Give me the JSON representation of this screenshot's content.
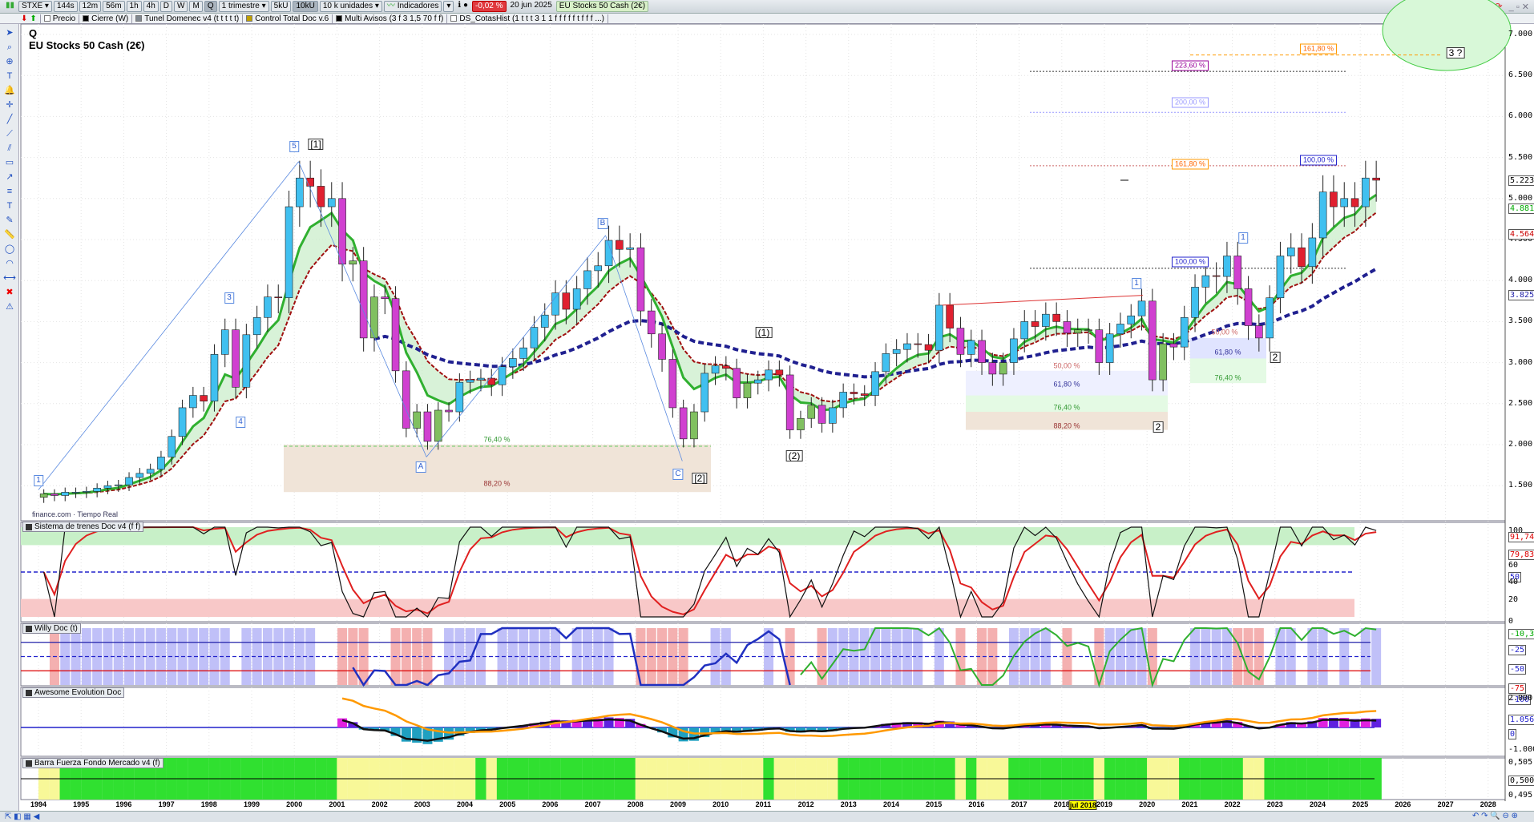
{
  "toolbar": {
    "symbol": "STXE",
    "intervals": [
      "144s",
      "12m",
      "56m",
      "1h",
      "4h",
      "D",
      "W",
      "M",
      "Q"
    ],
    "active_interval": "Q",
    "period": "1 trimestre",
    "units": [
      "5kU",
      "10kU"
    ],
    "active_unit": "10kU",
    "units_select": "10 k unidades",
    "indicators": "Indicadores",
    "change": "-0,02 %",
    "date": "20 jun 2025",
    "instrument": "EU Stocks 50 Cash (2€)"
  },
  "legend": [
    {
      "label": "Precio",
      "color": "#ffffff"
    },
    {
      "label": "Cierre (W)",
      "color": "#000000"
    },
    {
      "label": "Tunel Domenec v4 (t t t t t)",
      "color": "#808890"
    },
    {
      "label": "Control Total Doc v.6",
      "color": "#c0a000"
    },
    {
      "label": "Multi Avisos (3 f 3 1,5 70 f f)",
      "color": "#000000"
    },
    {
      "label": "DS_CotasHist (1 t t t 3 1 1 f f f f f t f f f ...)",
      "color": "#ffffff"
    }
  ],
  "chart": {
    "timeframe": "Q",
    "title": "EU Stocks 50 Cash (2€)",
    "source": "finance.com",
    "realtime": "Tiempo Real"
  },
  "panels": {
    "p2": "Sistema de trenes Doc v4 (f f)",
    "p3": "Willy Doc (t)",
    "p4": "Awesome Evolution Doc",
    "p5": "Barra Fuerza Fondo Mercado v4 (f)"
  },
  "price_axis": [
    "7.000",
    "6.500",
    "6.000",
    "5.500",
    "5.000",
    "4.500",
    "4.000",
    "3.500",
    "3.000",
    "2.500",
    "2.000",
    "1.500"
  ],
  "last_values": {
    "close": "5.223,2",
    "green_ema": "4.881,8",
    "red_ema": "4.564,8",
    "blue_ma": "3.825,2"
  },
  "p2_axis": [
    "100",
    "91,742",
    "79,832",
    "60",
    "50",
    "40",
    "20",
    "0"
  ],
  "p3_axis": [
    "-10,313",
    "-25",
    "-50",
    "-75",
    "-100"
  ],
  "p4_axis": [
    "2.000",
    "1.056,9",
    "0",
    "-1.000"
  ],
  "p5_axis": [
    "0,505",
    "0,5000",
    "0,495"
  ],
  "years": [
    "1994",
    "1995",
    "1996",
    "1997",
    "1998",
    "1999",
    "2000",
    "2001",
    "2002",
    "2003",
    "2004",
    "2005",
    "2006",
    "2007",
    "2008",
    "2009",
    "2010",
    "2011",
    "2012",
    "2013",
    "2014",
    "2015",
    "2016",
    "2017",
    "2018",
    "2019",
    "2020",
    "2021",
    "2022",
    "2023",
    "2024",
    "2025",
    "2026",
    "2027",
    "2028"
  ],
  "cursor_date": "jul 2018",
  "waves": [
    "1",
    "3",
    "4",
    "5",
    "[1]",
    "A",
    "B",
    "C",
    "[2]",
    "(1)",
    "(2)",
    "1",
    "2",
    "1",
    "2",
    "3 ?"
  ],
  "fibs": [
    "161,80 %",
    "223,60 %",
    "200,00 %",
    "161,80 %",
    "100,00 %",
    "100,00 %",
    "76,40 %",
    "88,20 %",
    "61,80 %",
    "50,00 %",
    "76,40 %",
    "88,20 %",
    "50,00 %",
    "61,80 %",
    "76,40 %"
  ],
  "colors": {
    "up": "#40c0f0",
    "down": "#e02030",
    "green_ema": "#30b030",
    "red_ema": "#a01010",
    "blue_ma": "#202090"
  },
  "chart_data": {
    "type": "candlestick",
    "start": "1994Q1",
    "quarterly_close": [
      1400,
      1380,
      1420,
      1420,
      1430,
      1470,
      1500,
      1510,
      1600,
      1650,
      1700,
      1850,
      2100,
      2450,
      2600,
      2530,
      3100,
      3400,
      2700,
      3340,
      3550,
      3800,
      3790,
      4900,
      5250,
      5150,
      4900,
      5000,
      4200,
      4240,
      3300,
      3800,
      3780,
      2900,
      2200,
      2400,
      2040,
      2420,
      2400,
      2760,
      2790,
      2810,
      2730,
      2950,
      3050,
      3180,
      3430,
      3580,
      3850,
      3650,
      3900,
      4120,
      4180,
      4490,
      4380,
      4400,
      3630,
      3350,
      3040,
      2450,
      2070,
      2400,
      2870,
      2960,
      2930,
      2570,
      2750,
      2790,
      2910,
      2850,
      2180,
      2320,
      2480,
      2260,
      2450,
      2640,
      2620,
      2600,
      2890,
      3110,
      3160,
      3230,
      3220,
      3150,
      3700,
      3420,
      3100,
      3270,
      3000,
      2860,
      3000,
      3290,
      3500,
      3440,
      3590,
      3500,
      3360,
      3400,
      3400,
      3000,
      3350,
      3470,
      3570,
      3750,
      2790,
      3230,
      3190,
      3550,
      3920,
      4060,
      4050,
      4300,
      3900,
      3450,
      3300,
      3790,
      4300,
      4400,
      4170,
      4520,
      5080,
      4900,
      5000,
      4900,
      5250,
      5223
    ],
    "ylim": [
      1200,
      7200
    ]
  }
}
